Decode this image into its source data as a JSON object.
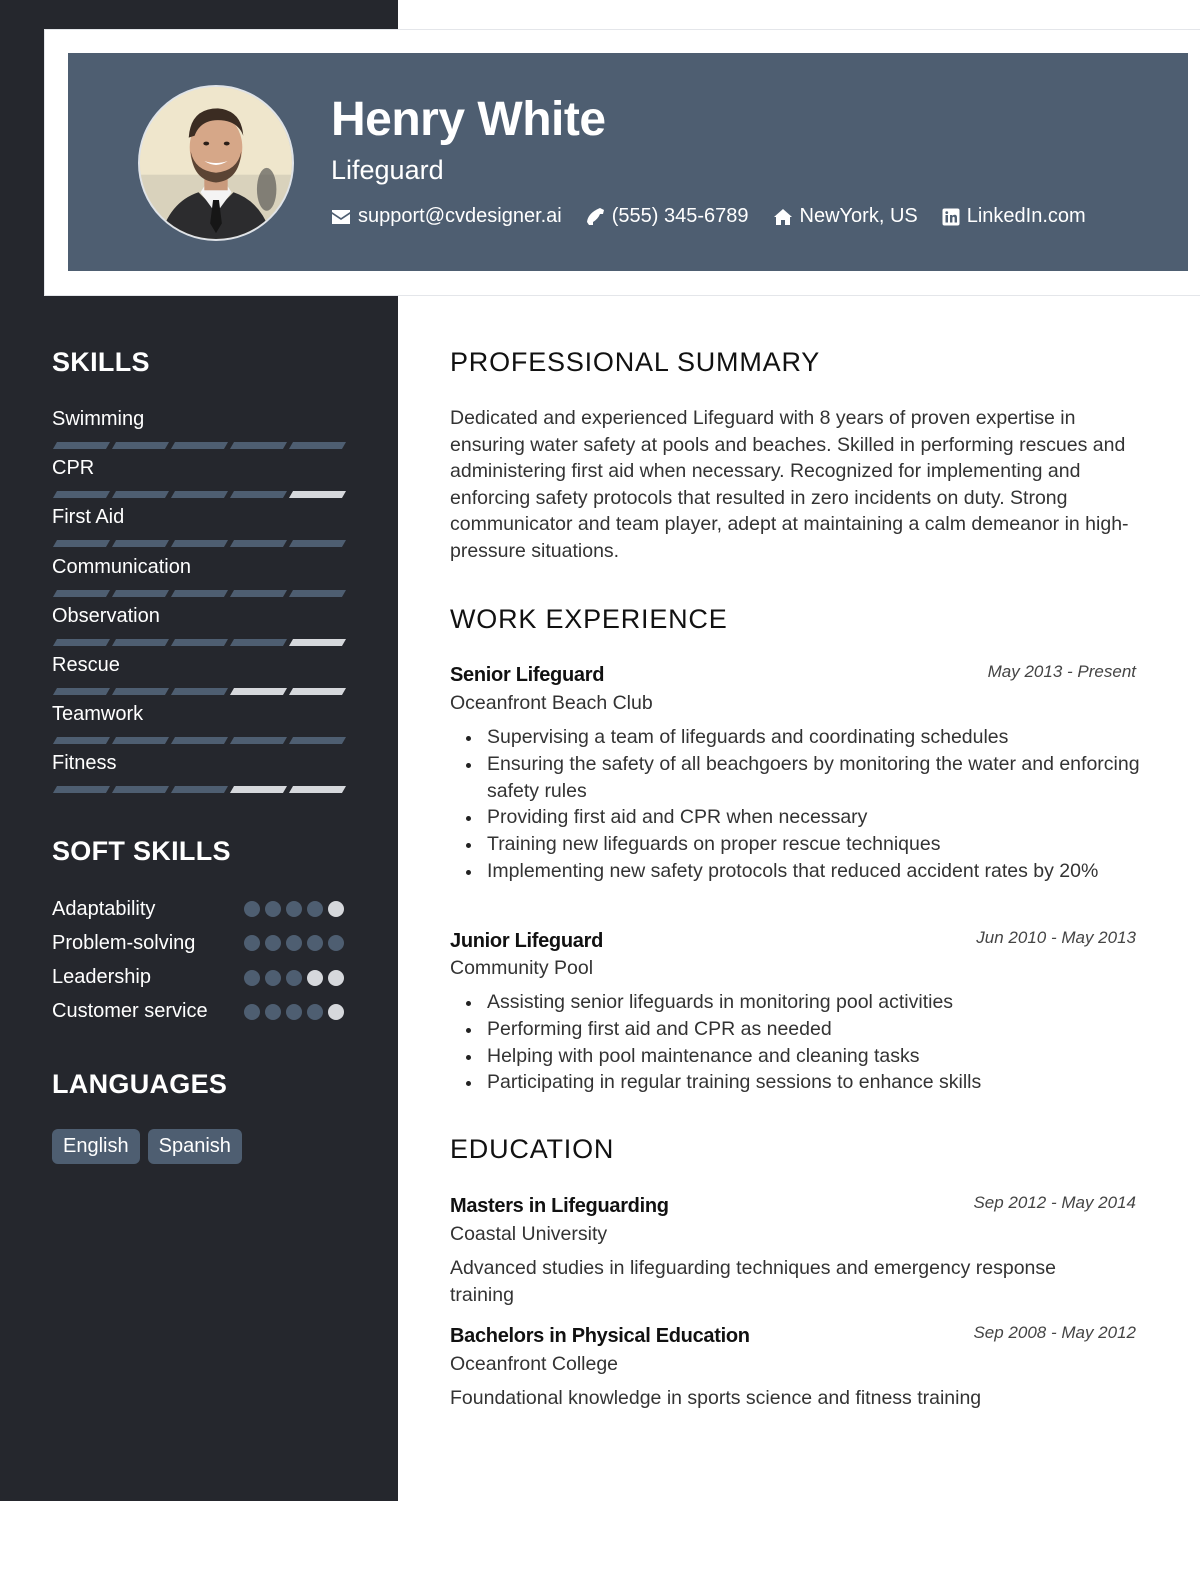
{
  "header": {
    "name": "Henry White",
    "role": "Lifeguard",
    "contacts": [
      {
        "icon": "envelope-icon",
        "text": "support@cvdesigner.ai"
      },
      {
        "icon": "phone-icon",
        "text": "(555) 345-6789"
      },
      {
        "icon": "home-icon",
        "text": "NewYork, US"
      },
      {
        "icon": "linkedin-icon",
        "text": "LinkedIn.com"
      }
    ]
  },
  "sidebar": {
    "skills_title": "SKILLS",
    "skills_max": 5,
    "skills": [
      {
        "name": "Swimming",
        "level": 5
      },
      {
        "name": "CPR",
        "level": 4
      },
      {
        "name": "First Aid",
        "level": 5
      },
      {
        "name": "Communication",
        "level": 5
      },
      {
        "name": "Observation",
        "level": 4
      },
      {
        "name": "Rescue",
        "level": 3
      },
      {
        "name": "Teamwork",
        "level": 5
      },
      {
        "name": "Fitness",
        "level": 3
      }
    ],
    "soft_skills_title": "SOFT SKILLS",
    "soft_skills": [
      {
        "name": "Adaptability",
        "level": 4
      },
      {
        "name": "Problem-solving",
        "level": 5
      },
      {
        "name": "Leadership",
        "level": 3
      },
      {
        "name": "Customer service",
        "level": 4
      }
    ],
    "languages_title": "LANGUAGES",
    "languages": [
      "English",
      "Spanish"
    ]
  },
  "colors": {
    "sidebar_bg": "#25272d",
    "accent": "#4e5e71",
    "empty_level": "#d6d8dc"
  },
  "main": {
    "summary": {
      "title": "PROFESSIONAL SUMMARY",
      "text": "Dedicated and experienced Lifeguard with 8 years of proven expertise in ensuring water safety at pools and beaches. Skilled in performing rescues and administering first aid when necessary. Recognized for implementing and enforcing safety protocols that resulted in zero incidents on duty. Strong communicator and team player, adept at maintaining a calm demeanor in high-pressure situations."
    },
    "experience": {
      "title": "WORK EXPERIENCE",
      "jobs": [
        {
          "title": "Senior Lifeguard",
          "company": "Oceanfront Beach Club",
          "dates": "May 2013 - Present",
          "bullets": [
            "Supervising a team of lifeguards and coordinating schedules",
            "Ensuring the safety of all beachgoers by monitoring the water and enforcing safety rules",
            "Providing first aid and CPR when necessary",
            "Training new lifeguards on proper rescue techniques",
            "Implementing new safety protocols that reduced accident rates by 20%"
          ]
        },
        {
          "title": "Junior Lifeguard",
          "company": "Community Pool",
          "dates": "Jun 2010 - May 2013",
          "bullets": [
            "Assisting senior lifeguards in monitoring pool activities",
            "Performing first aid and CPR as needed",
            "Helping with pool maintenance and cleaning tasks",
            "Participating in regular training sessions to enhance skills"
          ]
        }
      ]
    },
    "education": {
      "title": "EDUCATION",
      "items": [
        {
          "degree": "Masters in Lifeguarding",
          "school": "Coastal University",
          "dates": "Sep 2012 - May 2014",
          "description": "Advanced studies in lifeguarding techniques and emergency response training"
        },
        {
          "degree": "Bachelors in Physical Education",
          "school": "Oceanfront College",
          "dates": "Sep 2008 - May 2012",
          "description": "Foundational knowledge in sports science and fitness training"
        }
      ]
    }
  }
}
